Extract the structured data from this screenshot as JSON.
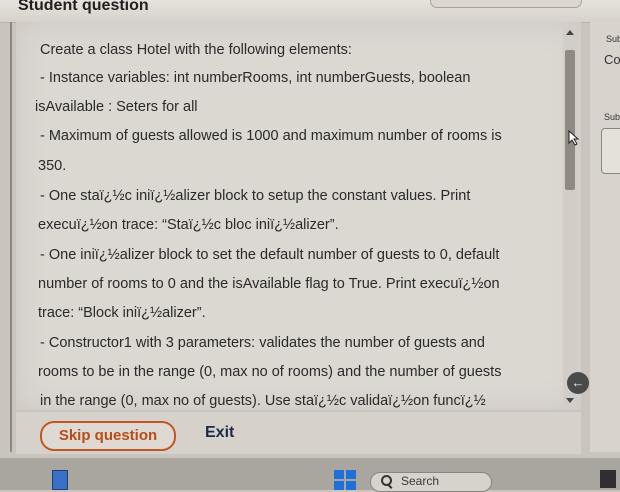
{
  "header": {
    "title": "Student question"
  },
  "question": {
    "lines": [
      "Create a class Hotel with the following elements:",
      "- Instance variables: int numberRooms, int numberGuests, boolean",
      "isAvailable : Seters for all",
      "- Maximum of guests allowed is 1000 and maximum number of rooms is",
      "350.",
      "- One staï¿½c iniï¿½alizer block to setup the constant values. Print",
      "execuï¿½on trace: “Staï¿½c bloc iniï¿½alizer”.",
      "- One iniï¿½alizer block to set the default number of guests to 0, default",
      "number of rooms to 0 and the isAvailable flag to True. Print execuï¿½on",
      "trace: “Block iniï¿½alizer”.",
      "- Constructor1 with 3 parameters: validates the number of guests and",
      "rooms to be in the range (0, max no of rooms) and the number of guests",
      "in the range (0, max no of guests). Use staï¿½c validaï¿½on funcï¿½"
    ]
  },
  "side": {
    "sub1": "Sub",
    "co": "Co",
    "sub2": "Sub"
  },
  "footer": {
    "skip_label": "Skip question",
    "exit_label": "Exit"
  },
  "taskbar": {
    "search_label": "Search"
  },
  "icons": {
    "back": "arrow-left-icon",
    "search": "search-icon",
    "start": "windows-start-icon"
  },
  "colors": {
    "skip_accent": "#b84d17",
    "exit_text": "#1c2a4a"
  }
}
